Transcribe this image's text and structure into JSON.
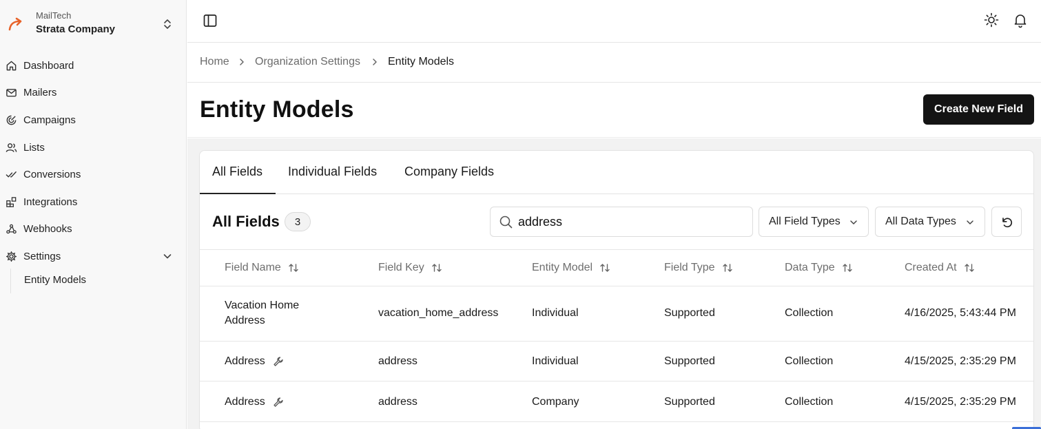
{
  "org": {
    "subtitle": "MailTech",
    "name": "Strata Company"
  },
  "sidebar": {
    "items": [
      {
        "label": "Dashboard",
        "icon": "home-icon"
      },
      {
        "label": "Mailers",
        "icon": "mail-icon"
      },
      {
        "label": "Campaigns",
        "icon": "campaign-icon"
      },
      {
        "label": "Lists",
        "icon": "users-icon"
      },
      {
        "label": "Conversions",
        "icon": "check-double-icon"
      },
      {
        "label": "Integrations",
        "icon": "blocks-icon"
      },
      {
        "label": "Webhooks",
        "icon": "webhook-icon"
      },
      {
        "label": "Settings",
        "icon": "gear-icon"
      }
    ],
    "sub_items": [
      {
        "label": "Entity Models"
      }
    ]
  },
  "breadcrumb": {
    "home": "Home",
    "org_settings": "Organization Settings",
    "current": "Entity Models"
  },
  "page": {
    "title": "Entity Models",
    "create_button": "Create New Field"
  },
  "tabs": [
    {
      "label": "All Fields",
      "active": true
    },
    {
      "label": "Individual Fields"
    },
    {
      "label": "Company Fields"
    }
  ],
  "toolbar": {
    "title": "All Fields",
    "count": "3",
    "search_value": "address",
    "field_type_filter": "All Field Types",
    "data_type_filter": "All Data Types"
  },
  "table": {
    "columns": [
      "Field Name",
      "Field Key",
      "Entity Model",
      "Field Type",
      "Data Type",
      "Created At"
    ],
    "rows": [
      {
        "name_line1": "Vacation Home",
        "name_line2": "Address",
        "key": "vacation_home_address",
        "entity": "Individual",
        "field_type": "Supported",
        "data_type": "Collection",
        "created": "4/16/2025, 5:43:44 PM",
        "system": false
      },
      {
        "name": "Address",
        "key": "address",
        "entity": "Individual",
        "field_type": "Supported",
        "data_type": "Collection",
        "created": "4/15/2025, 2:35:29 PM",
        "system": true
      },
      {
        "name": "Address",
        "key": "address",
        "entity": "Company",
        "field_type": "Supported",
        "data_type": "Collection",
        "created": "4/15/2025, 2:35:29 PM",
        "system": true
      }
    ]
  },
  "colors": {
    "accent_logo": "#e8632a",
    "primary_button": "#141414",
    "page_bg": "#f2f2f2"
  }
}
